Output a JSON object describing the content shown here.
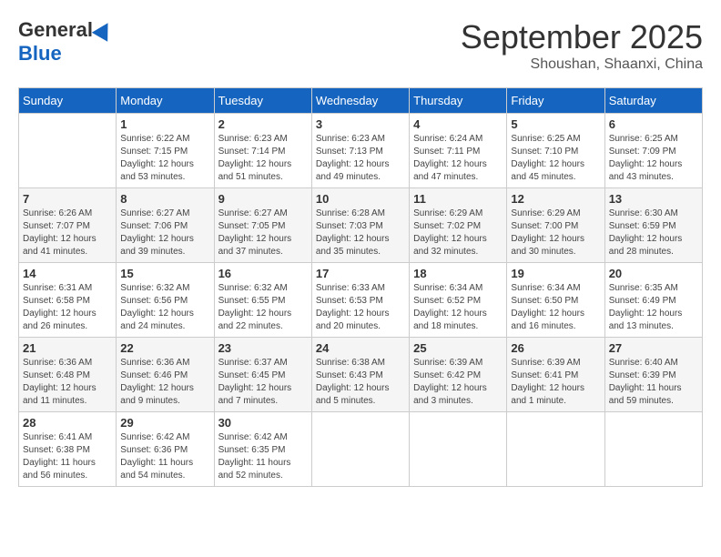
{
  "logo": {
    "general": "General",
    "blue": "Blue"
  },
  "header": {
    "month": "September 2025",
    "location": "Shoushan, Shaanxi, China"
  },
  "weekdays": [
    "Sunday",
    "Monday",
    "Tuesday",
    "Wednesday",
    "Thursday",
    "Friday",
    "Saturday"
  ],
  "weeks": [
    [
      {
        "day": "",
        "sunrise": "",
        "sunset": "",
        "daylight": ""
      },
      {
        "day": "1",
        "sunrise": "Sunrise: 6:22 AM",
        "sunset": "Sunset: 7:15 PM",
        "daylight": "Daylight: 12 hours and 53 minutes."
      },
      {
        "day": "2",
        "sunrise": "Sunrise: 6:23 AM",
        "sunset": "Sunset: 7:14 PM",
        "daylight": "Daylight: 12 hours and 51 minutes."
      },
      {
        "day": "3",
        "sunrise": "Sunrise: 6:23 AM",
        "sunset": "Sunset: 7:13 PM",
        "daylight": "Daylight: 12 hours and 49 minutes."
      },
      {
        "day": "4",
        "sunrise": "Sunrise: 6:24 AM",
        "sunset": "Sunset: 7:11 PM",
        "daylight": "Daylight: 12 hours and 47 minutes."
      },
      {
        "day": "5",
        "sunrise": "Sunrise: 6:25 AM",
        "sunset": "Sunset: 7:10 PM",
        "daylight": "Daylight: 12 hours and 45 minutes."
      },
      {
        "day": "6",
        "sunrise": "Sunrise: 6:25 AM",
        "sunset": "Sunset: 7:09 PM",
        "daylight": "Daylight: 12 hours and 43 minutes."
      }
    ],
    [
      {
        "day": "7",
        "sunrise": "Sunrise: 6:26 AM",
        "sunset": "Sunset: 7:07 PM",
        "daylight": "Daylight: 12 hours and 41 minutes."
      },
      {
        "day": "8",
        "sunrise": "Sunrise: 6:27 AM",
        "sunset": "Sunset: 7:06 PM",
        "daylight": "Daylight: 12 hours and 39 minutes."
      },
      {
        "day": "9",
        "sunrise": "Sunrise: 6:27 AM",
        "sunset": "Sunset: 7:05 PM",
        "daylight": "Daylight: 12 hours and 37 minutes."
      },
      {
        "day": "10",
        "sunrise": "Sunrise: 6:28 AM",
        "sunset": "Sunset: 7:03 PM",
        "daylight": "Daylight: 12 hours and 35 minutes."
      },
      {
        "day": "11",
        "sunrise": "Sunrise: 6:29 AM",
        "sunset": "Sunset: 7:02 PM",
        "daylight": "Daylight: 12 hours and 32 minutes."
      },
      {
        "day": "12",
        "sunrise": "Sunrise: 6:29 AM",
        "sunset": "Sunset: 7:00 PM",
        "daylight": "Daylight: 12 hours and 30 minutes."
      },
      {
        "day": "13",
        "sunrise": "Sunrise: 6:30 AM",
        "sunset": "Sunset: 6:59 PM",
        "daylight": "Daylight: 12 hours and 28 minutes."
      }
    ],
    [
      {
        "day": "14",
        "sunrise": "Sunrise: 6:31 AM",
        "sunset": "Sunset: 6:58 PM",
        "daylight": "Daylight: 12 hours and 26 minutes."
      },
      {
        "day": "15",
        "sunrise": "Sunrise: 6:32 AM",
        "sunset": "Sunset: 6:56 PM",
        "daylight": "Daylight: 12 hours and 24 minutes."
      },
      {
        "day": "16",
        "sunrise": "Sunrise: 6:32 AM",
        "sunset": "Sunset: 6:55 PM",
        "daylight": "Daylight: 12 hours and 22 minutes."
      },
      {
        "day": "17",
        "sunrise": "Sunrise: 6:33 AM",
        "sunset": "Sunset: 6:53 PM",
        "daylight": "Daylight: 12 hours and 20 minutes."
      },
      {
        "day": "18",
        "sunrise": "Sunrise: 6:34 AM",
        "sunset": "Sunset: 6:52 PM",
        "daylight": "Daylight: 12 hours and 18 minutes."
      },
      {
        "day": "19",
        "sunrise": "Sunrise: 6:34 AM",
        "sunset": "Sunset: 6:50 PM",
        "daylight": "Daylight: 12 hours and 16 minutes."
      },
      {
        "day": "20",
        "sunrise": "Sunrise: 6:35 AM",
        "sunset": "Sunset: 6:49 PM",
        "daylight": "Daylight: 12 hours and 13 minutes."
      }
    ],
    [
      {
        "day": "21",
        "sunrise": "Sunrise: 6:36 AM",
        "sunset": "Sunset: 6:48 PM",
        "daylight": "Daylight: 12 hours and 11 minutes."
      },
      {
        "day": "22",
        "sunrise": "Sunrise: 6:36 AM",
        "sunset": "Sunset: 6:46 PM",
        "daylight": "Daylight: 12 hours and 9 minutes."
      },
      {
        "day": "23",
        "sunrise": "Sunrise: 6:37 AM",
        "sunset": "Sunset: 6:45 PM",
        "daylight": "Daylight: 12 hours and 7 minutes."
      },
      {
        "day": "24",
        "sunrise": "Sunrise: 6:38 AM",
        "sunset": "Sunset: 6:43 PM",
        "daylight": "Daylight: 12 hours and 5 minutes."
      },
      {
        "day": "25",
        "sunrise": "Sunrise: 6:39 AM",
        "sunset": "Sunset: 6:42 PM",
        "daylight": "Daylight: 12 hours and 3 minutes."
      },
      {
        "day": "26",
        "sunrise": "Sunrise: 6:39 AM",
        "sunset": "Sunset: 6:41 PM",
        "daylight": "Daylight: 12 hours and 1 minute."
      },
      {
        "day": "27",
        "sunrise": "Sunrise: 6:40 AM",
        "sunset": "Sunset: 6:39 PM",
        "daylight": "Daylight: 11 hours and 59 minutes."
      }
    ],
    [
      {
        "day": "28",
        "sunrise": "Sunrise: 6:41 AM",
        "sunset": "Sunset: 6:38 PM",
        "daylight": "Daylight: 11 hours and 56 minutes."
      },
      {
        "day": "29",
        "sunrise": "Sunrise: 6:42 AM",
        "sunset": "Sunset: 6:36 PM",
        "daylight": "Daylight: 11 hours and 54 minutes."
      },
      {
        "day": "30",
        "sunrise": "Sunrise: 6:42 AM",
        "sunset": "Sunset: 6:35 PM",
        "daylight": "Daylight: 11 hours and 52 minutes."
      },
      {
        "day": "",
        "sunrise": "",
        "sunset": "",
        "daylight": ""
      },
      {
        "day": "",
        "sunrise": "",
        "sunset": "",
        "daylight": ""
      },
      {
        "day": "",
        "sunrise": "",
        "sunset": "",
        "daylight": ""
      },
      {
        "day": "",
        "sunrise": "",
        "sunset": "",
        "daylight": ""
      }
    ]
  ]
}
